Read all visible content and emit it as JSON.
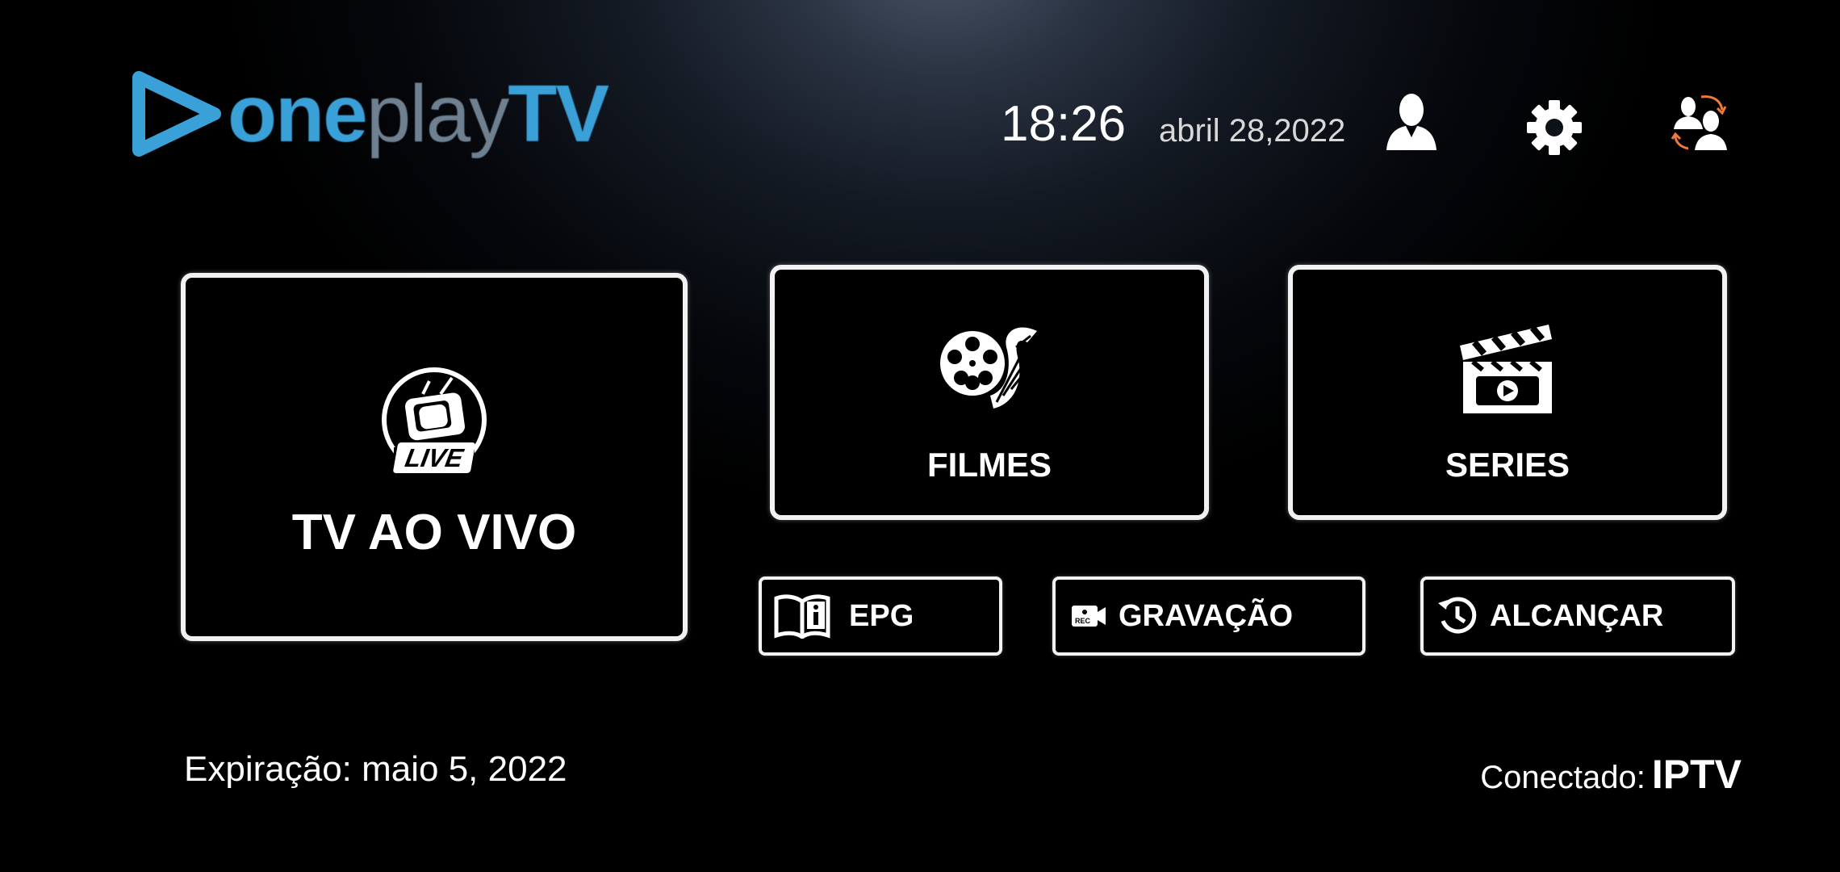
{
  "brand": {
    "one": "one",
    "play": "play",
    "tv": "TV"
  },
  "header": {
    "time": "18:26",
    "date": "abril 28,2022",
    "icons": [
      "user-icon",
      "gear-icon",
      "switch-users-icon"
    ]
  },
  "tiles": {
    "live": {
      "label": "TV AO VIVO",
      "badge": "LIVE"
    },
    "movies": {
      "label": "FILMES"
    },
    "series": {
      "label": "SERIES"
    }
  },
  "buttons": {
    "epg": "EPG",
    "recording": "GRAVAÇÃO",
    "recording_badge": "REC",
    "catchup": "ALCANÇAR"
  },
  "footer": {
    "expiry": "Expiração: maio 5, 2022",
    "connected_label": "Conectado:",
    "connected_value": "IPTV"
  },
  "colors": {
    "brand_blue": "#3aa0d8",
    "brand_gray": "#6f8090",
    "accent_orange": "#f07a3a"
  }
}
